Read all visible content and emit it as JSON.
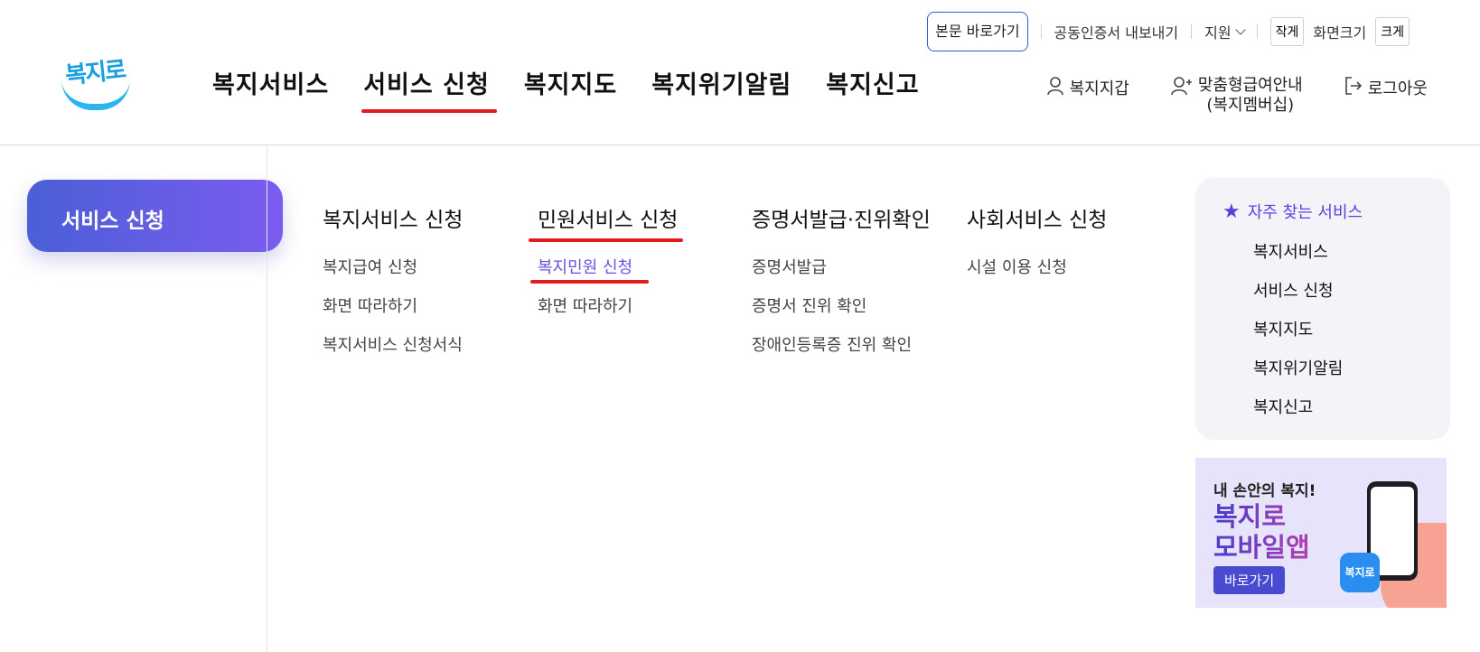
{
  "utility": {
    "skip_link": "본문 바로가기",
    "cert_export": "공동인증서 내보내기",
    "support": "지원",
    "font_smaller": "작게",
    "font_size_label": "화면크기",
    "font_larger": "크게"
  },
  "logo": {
    "text": "복지로"
  },
  "gnb": {
    "items": [
      {
        "label": "복지서비스"
      },
      {
        "label": "서비스 신청"
      },
      {
        "label": "복지지도"
      },
      {
        "label": "복지위기알림"
      },
      {
        "label": "복지신고"
      }
    ],
    "active_index": 1
  },
  "header_right": {
    "wallet": "복지지갑",
    "membership_line1": "맞춤형급여안내",
    "membership_line2": "(복지멤버십)",
    "logout": "로그아웃"
  },
  "side": {
    "title": "서비스 신청"
  },
  "menu": {
    "columns": [
      {
        "title": "복지서비스 신청",
        "items": [
          "복지급여 신청",
          "화면 따라하기",
          "복지서비스 신청서식"
        ]
      },
      {
        "title": "민원서비스 신청",
        "items": [
          "복지민원 신청",
          "화면 따라하기"
        ]
      },
      {
        "title": "증명서발급·진위확인",
        "items": [
          "증명서발급",
          "증명서 진위 확인",
          "장애인등록증 진위 확인"
        ]
      },
      {
        "title": "사회서비스 신청",
        "items": [
          "시설 이용 신청"
        ]
      }
    ]
  },
  "favorites": {
    "title": "자주 찾는 서비스",
    "items": [
      "복지서비스",
      "서비스 신청",
      "복지지도",
      "복지위기알림",
      "복지신고"
    ]
  },
  "banner": {
    "subtitle": "내 손안의 복지!",
    "title_line1": "복지로",
    "title_line2": "모바일앱",
    "button": "바로가기",
    "app_icon_text": "복지로"
  },
  "colors": {
    "accent": "#5a3fe0",
    "highlight": "#e41b1b",
    "brand": "#2ab4f0"
  }
}
